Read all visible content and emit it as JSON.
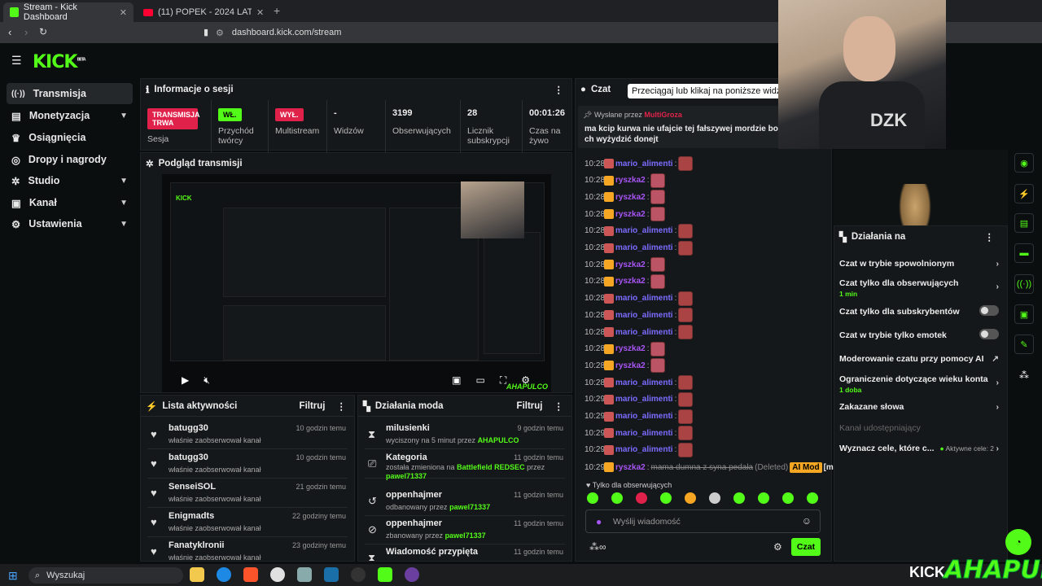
{
  "browser": {
    "tabs": [
      {
        "title": "Stream - Kick Dashboard",
        "active": true
      },
      {
        "title": "(11) POPEK - 2024 LATO (Official",
        "active": false
      }
    ],
    "url": "dashboard.kick.com/stream"
  },
  "brand": {
    "logo": "KICK",
    "beta": "BETA",
    "accent": "#53fc18"
  },
  "sidebar": {
    "items": [
      {
        "label": "Transmisja",
        "icon": "broadcast-icon",
        "active": true
      },
      {
        "label": "Monetyzacja",
        "icon": "money-icon",
        "expandable": true
      },
      {
        "label": "Osiągnięcia",
        "icon": "trophy-icon"
      },
      {
        "label": "Dropy i nagrody",
        "icon": "gift-icon"
      },
      {
        "label": "Studio",
        "icon": "studio-icon",
        "expandable": true
      },
      {
        "label": "Kanał",
        "icon": "channel-icon",
        "expandable": true
      },
      {
        "label": "Ustawienia",
        "icon": "gear-icon",
        "expandable": true
      }
    ]
  },
  "session": {
    "title": "Informacje o sesji",
    "stats": [
      {
        "badge": "TRANSMISJA TRWA",
        "label": "Sesja"
      },
      {
        "badge": "WŁ.",
        "label": "Przychód twórcy"
      },
      {
        "badge": "WYŁ.",
        "label": "Multistream"
      },
      {
        "value": "-",
        "label": "Widzów"
      },
      {
        "value": "3199",
        "label": "Obserwujących"
      },
      {
        "value": "28",
        "label": "Licznik subskrypcji"
      },
      {
        "value": "00:01:26",
        "label": "Czas na żywo"
      }
    ]
  },
  "preview": {
    "title": "Podgląd transmisji",
    "watermark": "AHAPULCO"
  },
  "activity": {
    "title": "Lista aktywności",
    "filter": "Filtruj",
    "rows": [
      {
        "name": "batugg30",
        "action": "właśnie zaobserwował kanał",
        "time": "10 godzin temu"
      },
      {
        "name": "batugg30",
        "action": "właśnie zaobserwował kanał",
        "time": "10 godzin temu"
      },
      {
        "name": "SenseiSOL",
        "action": "właśnie zaobserwował kanał",
        "time": "21 godzin temu"
      },
      {
        "name": "Enigmadts",
        "action": "właśnie zaobserwował kanał",
        "time": "22 godziny temu"
      },
      {
        "name": "Fanatyklronii",
        "action": "właśnie zaobserwował kanał",
        "time": "23 godziny temu"
      }
    ]
  },
  "mod": {
    "title": "Działania moda",
    "filter": "Filtruj",
    "rows": [
      {
        "name": "milusienki",
        "pre": "wyciszony na 5 minut przez",
        "by": "AHAPULCO",
        "post": "",
        "time": "9 godzin temu",
        "icon": "hourglass-icon"
      },
      {
        "name": "Kategoria",
        "pre": "została zmieniona na",
        "by": "Battlefield REDSEC",
        "post": "przez",
        "by2": "pawel71337",
        "time": "11 godzin temu",
        "icon": "category-icon"
      },
      {
        "name": "oppenhajmer",
        "pre": "odbanowany przez",
        "by": "pawel71337",
        "post": "",
        "time": "11 godzin temu",
        "icon": "unban-icon"
      },
      {
        "name": "oppenhajmer",
        "pre": "zbanowany przez",
        "by": "pawel71337",
        "post": "",
        "time": "11 godzin temu",
        "icon": "ban-icon"
      },
      {
        "name": "Wiadomość przypięta",
        "pre": "",
        "by": "",
        "post": "",
        "time": "11 godzin temu",
        "icon": "pin-icon"
      }
    ]
  },
  "chat": {
    "title": "Czat",
    "tooltip": "Przeciągaj lub klikaj na poniższe widżety",
    "pinned": {
      "sent_by": "Wysłane przez",
      "user": "MultiGroza",
      "text": "ma kcip kurwa nie ufajcie tej fałszywej mordzie bo ch wyżydzić donejt"
    },
    "messages": [
      {
        "time": "10:28",
        "user": "mario_alimenti",
        "color": "#7b6cff"
      },
      {
        "time": "10:28",
        "user": "ryszka2",
        "color": "#a855f7"
      },
      {
        "time": "10:28",
        "user": "ryszka2",
        "color": "#a855f7"
      },
      {
        "time": "10:28",
        "user": "ryszka2",
        "color": "#a855f7"
      },
      {
        "time": "10:28",
        "user": "mario_alimenti",
        "color": "#7b6cff"
      },
      {
        "time": "10:28",
        "user": "mario_alimenti",
        "color": "#7b6cff"
      },
      {
        "time": "10:28",
        "user": "ryszka2",
        "color": "#a855f7"
      },
      {
        "time": "10:28",
        "user": "ryszka2",
        "color": "#a855f7"
      },
      {
        "time": "10:28",
        "user": "mario_alimenti",
        "color": "#7b6cff"
      },
      {
        "time": "10:28",
        "user": "mario_alimenti",
        "color": "#7b6cff"
      },
      {
        "time": "10:28",
        "user": "mario_alimenti",
        "color": "#7b6cff"
      },
      {
        "time": "10:28",
        "user": "ryszka2",
        "color": "#a855f7"
      },
      {
        "time": "10:28",
        "user": "ryszka2",
        "color": "#a855f7"
      },
      {
        "time": "10:28",
        "user": "mario_alimenti",
        "color": "#7b6cff"
      },
      {
        "time": "10:29",
        "user": "mario_alimenti",
        "color": "#7b6cff"
      },
      {
        "time": "10:29",
        "user": "mario_alimenti",
        "color": "#7b6cff"
      },
      {
        "time": "10:29",
        "user": "mario_alimenti",
        "color": "#7b6cff"
      },
      {
        "time": "10:29",
        "user": "mario_alimenti",
        "color": "#7b6cff"
      }
    ],
    "last": {
      "time": "10:29",
      "user": "ryszka2",
      "deleted_text": "mama dumna z syna pedała",
      "deleted_label": "(Deleted)",
      "ai_badge": "AI Mod",
      "tail": "[mowa"
    },
    "followers_only": "Tylko dla obserwujących",
    "input_placeholder": "Wyślij wiadomość",
    "send": "Czat"
  },
  "mod_actions": {
    "title": "Działania na",
    "items": [
      {
        "label": "Czat w trybie spowolnionym",
        "type": "arrow"
      },
      {
        "label": "Czat tylko dla obserwujących",
        "sub": "1 min",
        "type": "arrow"
      },
      {
        "label": "Czat tylko dla subskrybentów",
        "type": "toggle"
      },
      {
        "label": "Czat w trybie tylko emotek",
        "type": "toggle"
      },
      {
        "label": "Moderowanie czatu przy pomocy AI",
        "type": "external"
      },
      {
        "label": "Ograniczenie dotyczące wieku konta",
        "sub": "1 doba",
        "type": "arrow"
      },
      {
        "label": "Zakazane słowa",
        "type": "arrow"
      },
      {
        "label": "Kanał udostępniający",
        "type": "none",
        "disabled": true
      },
      {
        "label": "Wyznacz cele, które c...",
        "extra": "Aktywne cele: 2",
        "type": "arrow"
      }
    ]
  },
  "taskbar": {
    "search": "Wyszukaj"
  },
  "overlay": {
    "kick": "KICK",
    "name": "AHAPULCO"
  }
}
